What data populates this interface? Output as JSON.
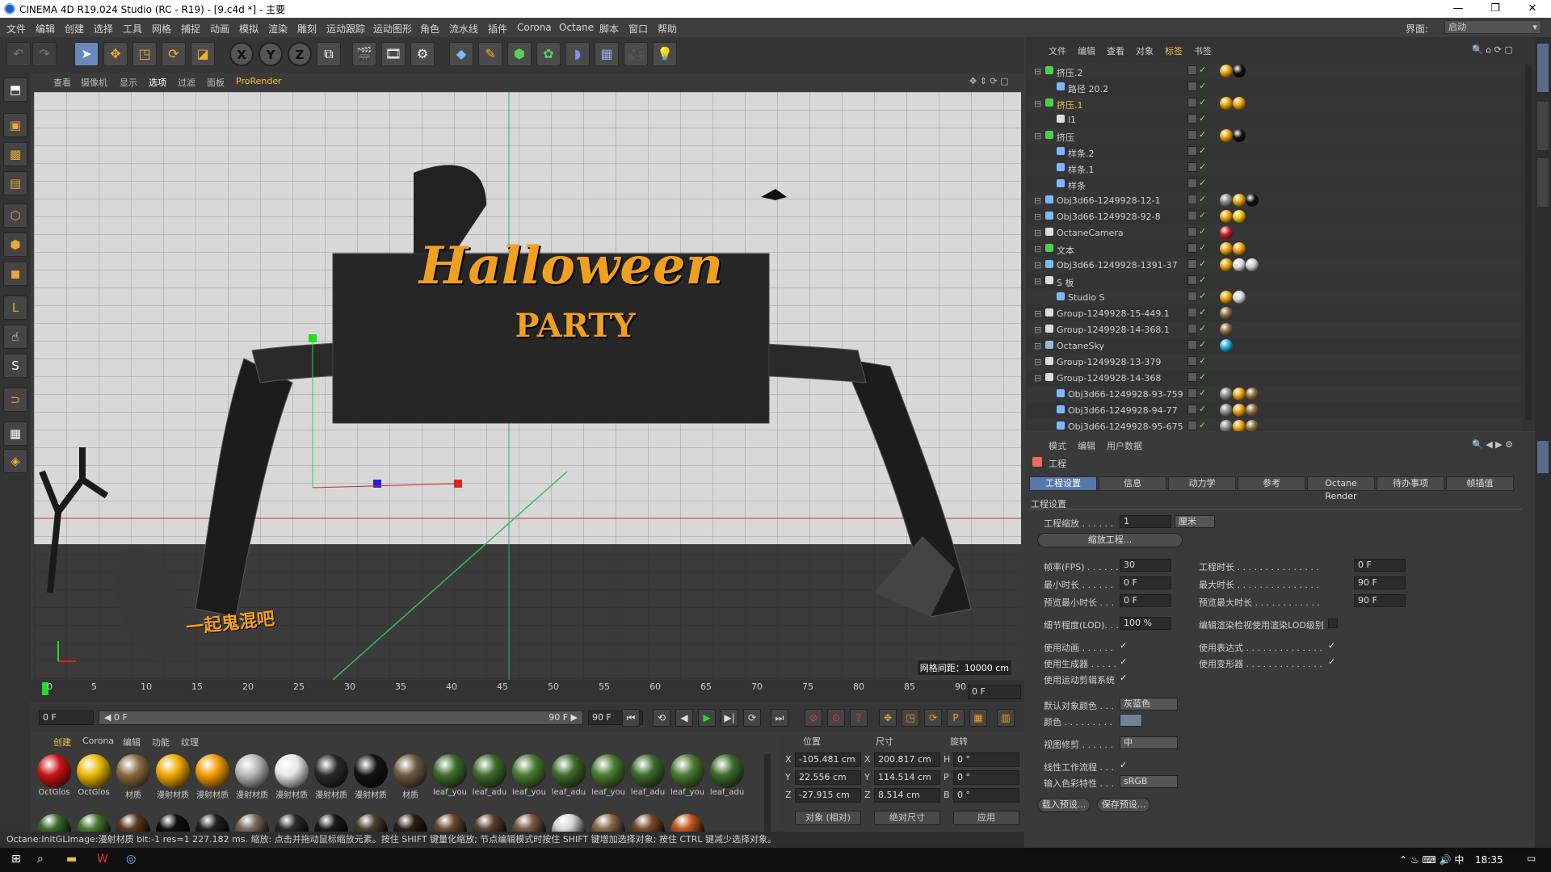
{
  "window": {
    "title": "CINEMA 4D R19.024 Studio (RC - R19) - [9.c4d *] - 主要"
  },
  "menu": [
    "文件",
    "编辑",
    "创建",
    "选择",
    "工具",
    "网格",
    "捕捉",
    "动画",
    "模拟",
    "渲染",
    "雕刻",
    "运动跟踪",
    "运动图形",
    "角色",
    "流水线",
    "插件",
    "Corona",
    "Octane",
    "脚本",
    "窗口",
    "帮助"
  ],
  "layout": {
    "label": "界面:",
    "value": "启动"
  },
  "viewport": {
    "menu": [
      "查看",
      "摄像机",
      "显示",
      "选项",
      "过滤",
      "面板",
      "ProRender"
    ],
    "grid_info": "网格间距：10000 cm",
    "scene_title": "Halloween",
    "scene_subtitle": "PARTY",
    "sign_text": "一起鬼混吧"
  },
  "timeline": {
    "ticks": [
      "0",
      "5",
      "10",
      "15",
      "20",
      "25",
      "30",
      "35",
      "40",
      "45",
      "50",
      "55",
      "60",
      "65",
      "70",
      "75",
      "80",
      "85",
      "90"
    ],
    "current_frame": "0 F",
    "start": "0 F",
    "slider_start": "◀ 0 F",
    "slider_end": "90 F ▶",
    "end": "90 F"
  },
  "materials": {
    "menu": [
      "创建",
      "Corona",
      "编辑",
      "功能",
      "纹理"
    ],
    "items": [
      {
        "label": "OctGlos",
        "color": "#c81414"
      },
      {
        "label": "OctGlos",
        "color": "#e8b800"
      },
      {
        "label": "材质",
        "color": "#8a6a40"
      },
      {
        "label": "漫射材质",
        "color": "#f2a800"
      },
      {
        "label": "漫射材质",
        "color": "#f29a00"
      },
      {
        "label": "漫射材质",
        "color": "#b8b8b8"
      },
      {
        "label": "漫射材质",
        "color": "#e6e6e6"
      },
      {
        "label": "漫射材质",
        "color": "#2a2a2a"
      },
      {
        "label": "漫射材质",
        "color": "#141414"
      },
      {
        "label": "材质",
        "color": "#6b5a40"
      },
      {
        "label": "leaf_you",
        "color": "#3d6b2a"
      },
      {
        "label": "leaf_adu",
        "color": "#3d6b2a"
      },
      {
        "label": "leaf_you",
        "color": "#4a7a30"
      },
      {
        "label": "leaf_adu",
        "color": "#3d6b2a"
      },
      {
        "label": "leaf_you",
        "color": "#4a7a30"
      },
      {
        "label": "leaf_adu",
        "color": "#3d6b2a"
      },
      {
        "label": "leaf_you",
        "color": "#4a7a30"
      },
      {
        "label": "leaf_adu",
        "color": "#3d6b2a"
      }
    ],
    "row2_colors": [
      "#3d6b2a",
      "#4a7a30",
      "#5a3a20",
      "#111111",
      "#222222",
      "#7a6a5a",
      "#2a2a2a",
      "#1a1a1a",
      "#4a4030",
      "#2a2018",
      "#6b4a30",
      "#5a4030",
      "#7a5a40",
      "#d8d8d8",
      "#8a6a4a",
      "#7a4a2a",
      "#c05a20"
    ]
  },
  "coords": {
    "headers": [
      "位置",
      "尺寸",
      "旋转"
    ],
    "pos": {
      "X": "-105.481 cm",
      "Y": "22.556 cm",
      "Z": "-27.915 cm"
    },
    "size": {
      "X": "200.817 cm",
      "Y": "114.514 cm",
      "Z": "8.514 cm"
    },
    "rot": {
      "H": "0 °",
      "P": "0 °",
      "B": "0 °"
    },
    "mode": "对象 (相对)",
    "size_mode": "绝对尺寸",
    "apply": "应用"
  },
  "status": "Octane:InitGLImage:漫射材质 bit:-1 res=1 227.182 ms.    缩放: 点击并拖动鼠标缩放元素。按住 SHIFT 键量化缩放; 节点编辑模式时按住 SHIFT 键增加选择对象; 按住 CTRL 键减少选择对象。",
  "object_manager": {
    "menu": [
      "文件",
      "编辑",
      "查看",
      "对象",
      "标签",
      "书签"
    ],
    "rows": [
      {
        "name": "挤压.2",
        "indent": 0,
        "type": "extrude",
        "tags": [
          "#e8a000",
          "#111111"
        ]
      },
      {
        "name": "路径 20.2",
        "indent": 1,
        "type": "spline",
        "tags": []
      },
      {
        "name": "挤压.1",
        "indent": 0,
        "type": "extrude",
        "tags": [
          "#e8a000",
          "#f0a000"
        ]
      },
      {
        "name": "l1",
        "indent": 1,
        "type": "null",
        "tags": []
      },
      {
        "name": "挤压",
        "indent": 0,
        "type": "extrude",
        "tags": [
          "#e8a000",
          "#111111"
        ]
      },
      {
        "name": "样条.2",
        "indent": 1,
        "type": "spline",
        "tags": []
      },
      {
        "name": "样条.1",
        "indent": 1,
        "type": "spline",
        "tags": []
      },
      {
        "name": "样条",
        "indent": 1,
        "type": "spline",
        "tags": []
      },
      {
        "name": "Obj3d66-1249928-12-1",
        "indent": 0,
        "type": "poly",
        "tags": [
          "#888888",
          "#e8a000",
          "#111111"
        ]
      },
      {
        "name": "Obj3d66-1249928-92-8",
        "indent": 0,
        "type": "poly",
        "tags": [
          "#e8a000",
          "#f0c000"
        ]
      },
      {
        "name": "OctaneCamera",
        "indent": 0,
        "type": "camera",
        "tags": [
          "#cc2222"
        ]
      },
      {
        "name": "文本",
        "indent": 0,
        "type": "text",
        "tags": [
          "#e8a000",
          "#f0a000"
        ]
      },
      {
        "name": "Obj3d66-1249928-1391-37",
        "indent": 0,
        "type": "poly",
        "tags": [
          "#e8a000",
          "#dddddd",
          "#cccccc"
        ]
      },
      {
        "name": "S 板",
        "indent": 0,
        "type": "null",
        "tags": []
      },
      {
        "name": "Studio S",
        "indent": 1,
        "type": "poly",
        "tags": [
          "#e8a000",
          "#dddddd"
        ]
      },
      {
        "name": "Group-1249928-15-449.1",
        "indent": 0,
        "type": "null",
        "tags": [
          "#8a6a40"
        ]
      },
      {
        "name": "Group-1249928-14-368.1",
        "indent": 0,
        "type": "null",
        "tags": [
          "#8a6a40"
        ]
      },
      {
        "name": "OctaneSky",
        "indent": 0,
        "type": "sky",
        "tags": [
          "#22aadd"
        ]
      },
      {
        "name": "Group-1249928-13-379",
        "indent": 0,
        "type": "null",
        "tags": []
      },
      {
        "name": "Group-1249928-14-368",
        "indent": 0,
        "type": "null",
        "tags": []
      },
      {
        "name": "Obj3d66-1249928-93-759",
        "indent": 1,
        "type": "poly",
        "tags": [
          "#888888",
          "#e8a000",
          "#8a6a40"
        ]
      },
      {
        "name": "Obj3d66-1249928-94-77",
        "indent": 1,
        "type": "poly",
        "tags": [
          "#888888",
          "#e8a000",
          "#8a6a40"
        ]
      },
      {
        "name": "Obj3d66-1249928-95-675",
        "indent": 1,
        "type": "poly",
        "tags": [
          "#888888",
          "#e8a000",
          "#8a6a40"
        ]
      }
    ]
  },
  "attributes": {
    "menu": [
      "模式",
      "编辑",
      "用户数据"
    ],
    "title": "工程",
    "tabs": [
      "工程设置",
      "信息",
      "动力学",
      "参考",
      "Octane Render",
      "待办事项",
      "帧插值"
    ],
    "section": "工程设置",
    "scale_label": "工程缩放 . . . . . .",
    "scale_value": "1",
    "scale_unit": "厘米",
    "scale_button": "缩放工程...",
    "fps_label": "帧率(FPS) . . . . . .",
    "fps": "30",
    "project_time_label": "工程时长 . . . . . . . . . . . . . . .",
    "project_time": "0 F",
    "min_time_label": "最小时长 . . . . . .",
    "min_time": "0 F",
    "max_time_label": "最大时长 . . . . . . . . . . . . . . .",
    "max_time": "90 F",
    "prev_min_label": "预览最小时长 . . .",
    "prev_min": "0 F",
    "prev_max_label": "预览最大时长 . . . . . . . . . . . .",
    "prev_max": "90 F",
    "lod_label": "细节程度(LOD). . . .",
    "lod": "100 %",
    "lod_render_label": "编辑渲染检视使用渲染LOD级别",
    "use_anim": "使用动画 . . . . . .",
    "use_expr": "使用表达式 . . . . . . . . . . . . . .",
    "use_gen": "使用生成器 . . . . .",
    "use_deform": "使用变形器 . . . . . . . . . . . . . .",
    "use_mograph": "使用运动剪辑系统",
    "default_color_label": "默认对象颜色 . . .",
    "default_color": "灰蓝色",
    "color_label": "颜色 . . . . . . . . .",
    "view_clip_label": "视图修剪 . . . . . .",
    "view_clip": "中",
    "linear_label": "线性工作流程 . . .",
    "input_color_label": "输入色彩特性 . . .",
    "input_color": "sRGB",
    "load_preset": "载入预设...",
    "save_preset": "保存预设..."
  },
  "taskbar": {
    "time": "18:35"
  }
}
